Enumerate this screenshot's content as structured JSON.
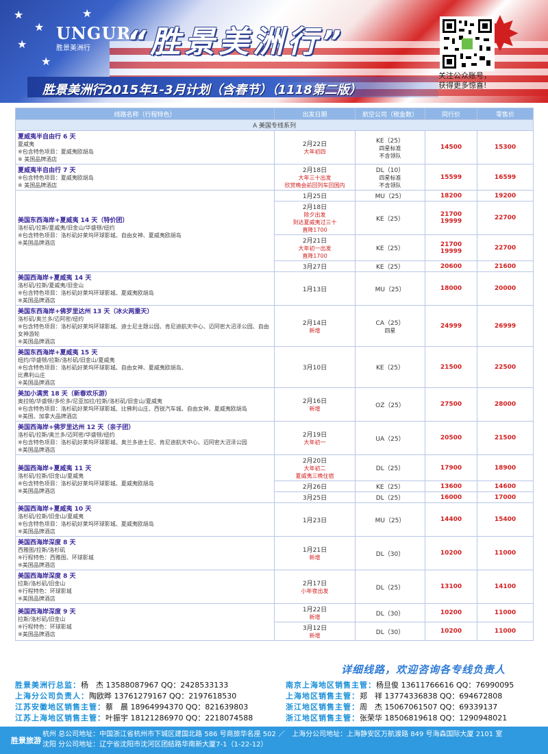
{
  "header": {
    "logo_mark": "UNGUR",
    "logo_sub": "胜景美洲行",
    "title": "“胜景美洲行”",
    "qr_caption": [
      "关注公众账号，",
      "获得更多惊喜!"
    ],
    "plan_title": "胜景美洲行2015年1-3月计划（含春节）（1118第二版）"
  },
  "table": {
    "headers": [
      "线路名称（行程特色）",
      "出发日期",
      "航空公司（税金数）",
      "同行价",
      "零售价"
    ],
    "section": "A 美国专线系列",
    "groups": [
      {
        "name": "夏威夷半自由行 6 天",
        "route": "  夏威夷",
        "lines": [
          "※包含特色项目：夏威夷欧胡岛",
          "※ 美国品牌酒店"
        ],
        "rows": [
          {
            "date": "2月22日",
            "note": "大年初四",
            "airline": "KE（25）",
            "air_note": "四星标准",
            "air_note2": "不含领队",
            "peer": "14500",
            "retail": "15300"
          }
        ]
      },
      {
        "name": "夏威夷半自由行 7 天",
        "route": "",
        "lines": [
          "※包含特色项目：夏威夷欧胡岛",
          "※ 美国品牌酒店"
        ],
        "rows": [
          {
            "date": "2月18日",
            "note": "大年三十出发",
            "note2": "欣赏晚会前回列车回国内",
            "airline": "DL（10）",
            "air_note": "四星标准",
            "air_note2": "不含领队",
            "peer": "15599",
            "retail": "16599"
          }
        ]
      },
      {
        "name": "美国东西海岸+夏威夷 14 天（特价团）",
        "route": "洛杉矶/拉斯/夏威夷/旧金山/华盛顿/纽约",
        "lines": [
          "※包含特色项目：洛杉矶好莱坞环球影城、自由女神、夏威夷欧胡岛",
          "※美国品牌酒店"
        ],
        "rows": [
          {
            "date": "1月25日",
            "airline": "MU（25）",
            "peer": "18200",
            "retail": "19200"
          },
          {
            "date": "2月18日",
            "note": "除夕出发",
            "note2": "到达夏威夷过三十",
            "note3": "直降1700",
            "airline": "KE（25）",
            "peer": "21700",
            "peer2": "19999",
            "retail": "22700"
          },
          {
            "date": "2月21日",
            "note": "大年初一出发",
            "note2": "直降1700",
            "airline": "KE（25）",
            "peer": "21700",
            "peer2": "19999",
            "retail": "22700"
          },
          {
            "date": "3月27日",
            "airline": "KE（25）",
            "peer": "20600",
            "retail": "21600"
          }
        ]
      },
      {
        "name": "美国西海岸+夏威夷 14 天",
        "route": "洛杉矶/拉斯/夏威夷/旧金山",
        "lines": [
          "※包含特色项目：洛杉矶好莱坞环球影城、夏威夷欧胡岛",
          "※美国品牌酒店"
        ],
        "rows": [
          {
            "date": "1月13日",
            "airline": "MU（25）",
            "peer": "18000",
            "retail": "20000"
          }
        ]
      },
      {
        "name": "美国东西海岸+佛罗里达州 13 天（冰火两重天）",
        "route": "洛杉矶/奥兰多/迈阿密/纽约",
        "lines": [
          "※包含特色项目：洛杉矶好莱坞环球影城、迪士尼主题公园、肯尼迪航天中心、迈阿密大沼泽公园、自由女神游轮",
          "※美国品牌酒店"
        ],
        "rows": [
          {
            "date": "2月14日",
            "note": "新增",
            "airline": "CA（25）",
            "air_note": "四星",
            "peer": "24999",
            "retail": "26999"
          }
        ]
      },
      {
        "name": "美国东西海岸+夏威夷 15 天",
        "route": "纽约/华盛顿/拉斯/洛杉矶/旧金山/夏威夷",
        "lines": [
          "※包含特色项目：洛杉矶好莱坞环球影城、自由女神、夏威夷欧胡岛、",
          "比弗利山庄",
          "※美国品牌酒店"
        ],
        "rows": [
          {
            "date": "3月10日",
            "airline": "KE（25）",
            "peer": "21500",
            "retail": "22500"
          }
        ]
      },
      {
        "name": "美加小满贯 18 天（新春欢乐游）",
        "route": "奥拉帕/华盛顿/多伦多/尼亚加拉/拉斯/洛杉矶/旧金山/夏威夷",
        "lines": [
          "※包含特色项目：洛杉矶好莱坞环球影城、比佛利山庄、西锐汽车城、自由女神、夏威夷欧胡岛",
          "※美国、加拿大品牌酒店"
        ],
        "rows": [
          {
            "date": "2月16日",
            "note": "新增",
            "airline": "OZ（25）",
            "peer": "27500",
            "retail": "28000"
          }
        ]
      },
      {
        "name": "美国西海岸+佛罗里达州 12 天（亲子团）",
        "route": "洛杉矶/拉斯/奥兰多/迈阿密/华盛顿/纽约",
        "lines": [
          "※包含特色项目：洛杉矶好莱坞环球影城、奥兰多迪士尼、肯尼迪航天中心、迈阿密大沼泽公园",
          "※美国品牌酒店"
        ],
        "rows": [
          {
            "date": "2月19日",
            "note": "大年初一",
            "airline": "UA（25）",
            "peer": "20500",
            "retail": "21500"
          }
        ]
      },
      {
        "name": "美国西海岸+夏威夷 11 天",
        "route": "洛杉矶/拉斯/旧金山/夏威夷",
        "lines": [
          "※包含特色项目：洛杉矶好莱坞环球影城、夏威夷欧胡岛",
          "※美国品牌酒店"
        ],
        "rows": [
          {
            "date": "2月20日",
            "note": "大年初二",
            "note2": "夏威夷三晚住宿",
            "airline": "DL（25）",
            "peer": "17900",
            "retail": "18900"
          },
          {
            "date": "2月26日",
            "airline": "KE（25）",
            "peer": "13600",
            "retail": "14600"
          },
          {
            "date": "3月25日",
            "airline": "DL（25）",
            "peer": "16000",
            "retail": "17000"
          }
        ]
      },
      {
        "name": "美国西海岸+夏威夷 10 天",
        "route": "洛杉矶/拉斯/旧金山/夏威夷",
        "lines": [
          "※包含特色项目：洛杉矶好莱坞环球影城、夏威夷欧胡岛",
          "※美国品牌酒店"
        ],
        "rows": [
          {
            "date": "1月23日",
            "airline": "MU（25）",
            "peer": "14400",
            "retail": "15400"
          }
        ]
      },
      {
        "name": "美国西海岸深度 8 天",
        "route": "西雅图/拉斯/洛杉矶",
        "lines": [
          "※行程特色：西雅图、环球影城",
          "※美国品牌酒店"
        ],
        "rows": [
          {
            "date": "1月21日",
            "note": "新增",
            "airline": "DL（30）",
            "peer": "10200",
            "retail": "11000"
          }
        ]
      },
      {
        "name": "美国西海岸深度 8 天",
        "route": "拉斯/洛杉矶/旧金山",
        "lines": [
          "※行程特色：环球影城",
          "※美国品牌酒店"
        ],
        "rows": [
          {
            "date": "2月17日",
            "note": "小年夜出发",
            "airline": "DL（25）",
            "peer": "13100",
            "retail": "14100"
          }
        ]
      },
      {
        "name": "美国西海岸深度 9 天",
        "route": "拉斯/洛杉矶/旧金山",
        "lines": [
          "※行程特色：环球影城",
          "※美国品牌酒店"
        ],
        "rows": [
          {
            "date": "1月22日",
            "note": "新增",
            "airline": "DL（30）",
            "peer": "10200",
            "retail": "11000"
          },
          {
            "date": "3月12日",
            "note": "新增",
            "airline": "DL（30）",
            "peer": "10200",
            "retail": "11000"
          }
        ]
      }
    ]
  },
  "consult": "详细线路，欢迎咨询各专线负责人",
  "contacts": [
    {
      "lk": "胜景美洲行总监：",
      "lv": "杨　杰 13588087967 QQ：2428533133",
      "rk": "南京上海地区销售主管：",
      "rv": "杨旦俊 13611766616 QQ：76990095"
    },
    {
      "lk": "上海分公司负责人：",
      "lv": "陶欧晔 13761279167 QQ：2197618530",
      "rk": "上海地区销售主管：",
      "rv": "郑　祥 13774336838 QQ：694672808"
    },
    {
      "lk": "江苏安徽地区销售主管：",
      "lv": "蔡　晨 18964994370 QQ：821639803",
      "rk": "浙江地区销售主管：",
      "rv": "周　杰 15067061507 QQ：69339137"
    },
    {
      "lk": "江苏上海地区销售主管：",
      "lv": "叶振宇 18121286970 QQ：2218074588",
      "rk": "浙江地区销售主管：",
      "rv": "张荣华 18506819618 QQ：1290948021"
    }
  ],
  "footer": {
    "brand": "胜景旅游",
    "line1": "杭州 总公司地址：中国浙江省杭州市下城区建国北路 586 号商旅华名座 502 ／　上海分公司地址：上海静安区万航渡路 849 号海森国际大厦 2101 室",
    "line2": "沈阳 分公司地址：辽宁省沈阳市沈河区团结路华南新大厦7-1（1-22-12）"
  }
}
